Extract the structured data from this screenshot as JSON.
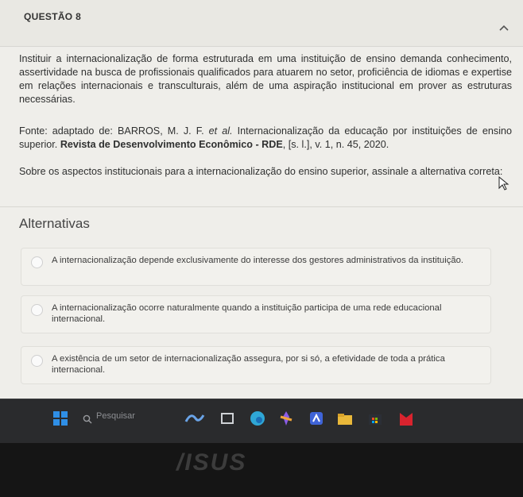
{
  "question": {
    "title": "QUESTÃO 8",
    "statement": "Instituir a internacionalização de forma estruturada em uma instituição de ensino demanda conhecimento, assertividade na busca de profissionais qualificados para atuarem no setor, proficiência de idiomas e expertise em relações internacionais e transculturais, além de uma aspiração institucional em prover as estruturas necessárias.",
    "source_prefix": "Fonte: adaptado de: BARROS, M. J. F. ",
    "source_etal": "et al.",
    "source_middle": " Internacionalização da educação por instituições de ensino superior. ",
    "source_journal": "Revista de Desenvolvimento Econômico - RDE",
    "source_suffix": ", [s. l.], v. 1, n. 45, 2020.",
    "prompt": "Sobre os aspectos institucionais para a internacionalização do ensino superior, assinale a alternativa correta:"
  },
  "alternatives": {
    "heading": "Alternativas",
    "items": [
      {
        "text": "A internacionalização depende exclusivamente do interesse dos gestores administrativos da instituição."
      },
      {
        "text": "A internacionalização ocorre naturalmente quando a instituição participa de uma rede educacional internacional."
      },
      {
        "text": "A existência de um setor de internacionalização assegura, por si só, a efetividade de toda a prática internacional."
      }
    ]
  },
  "taskbar": {
    "search_placeholder": "Pesquisar"
  },
  "laptop": {
    "brand": "/ISUS"
  },
  "colors": {
    "page_bg": "#efeeea",
    "taskbar_bg": "#2a2b2d",
    "windows_blue": "#2f8fe6"
  }
}
